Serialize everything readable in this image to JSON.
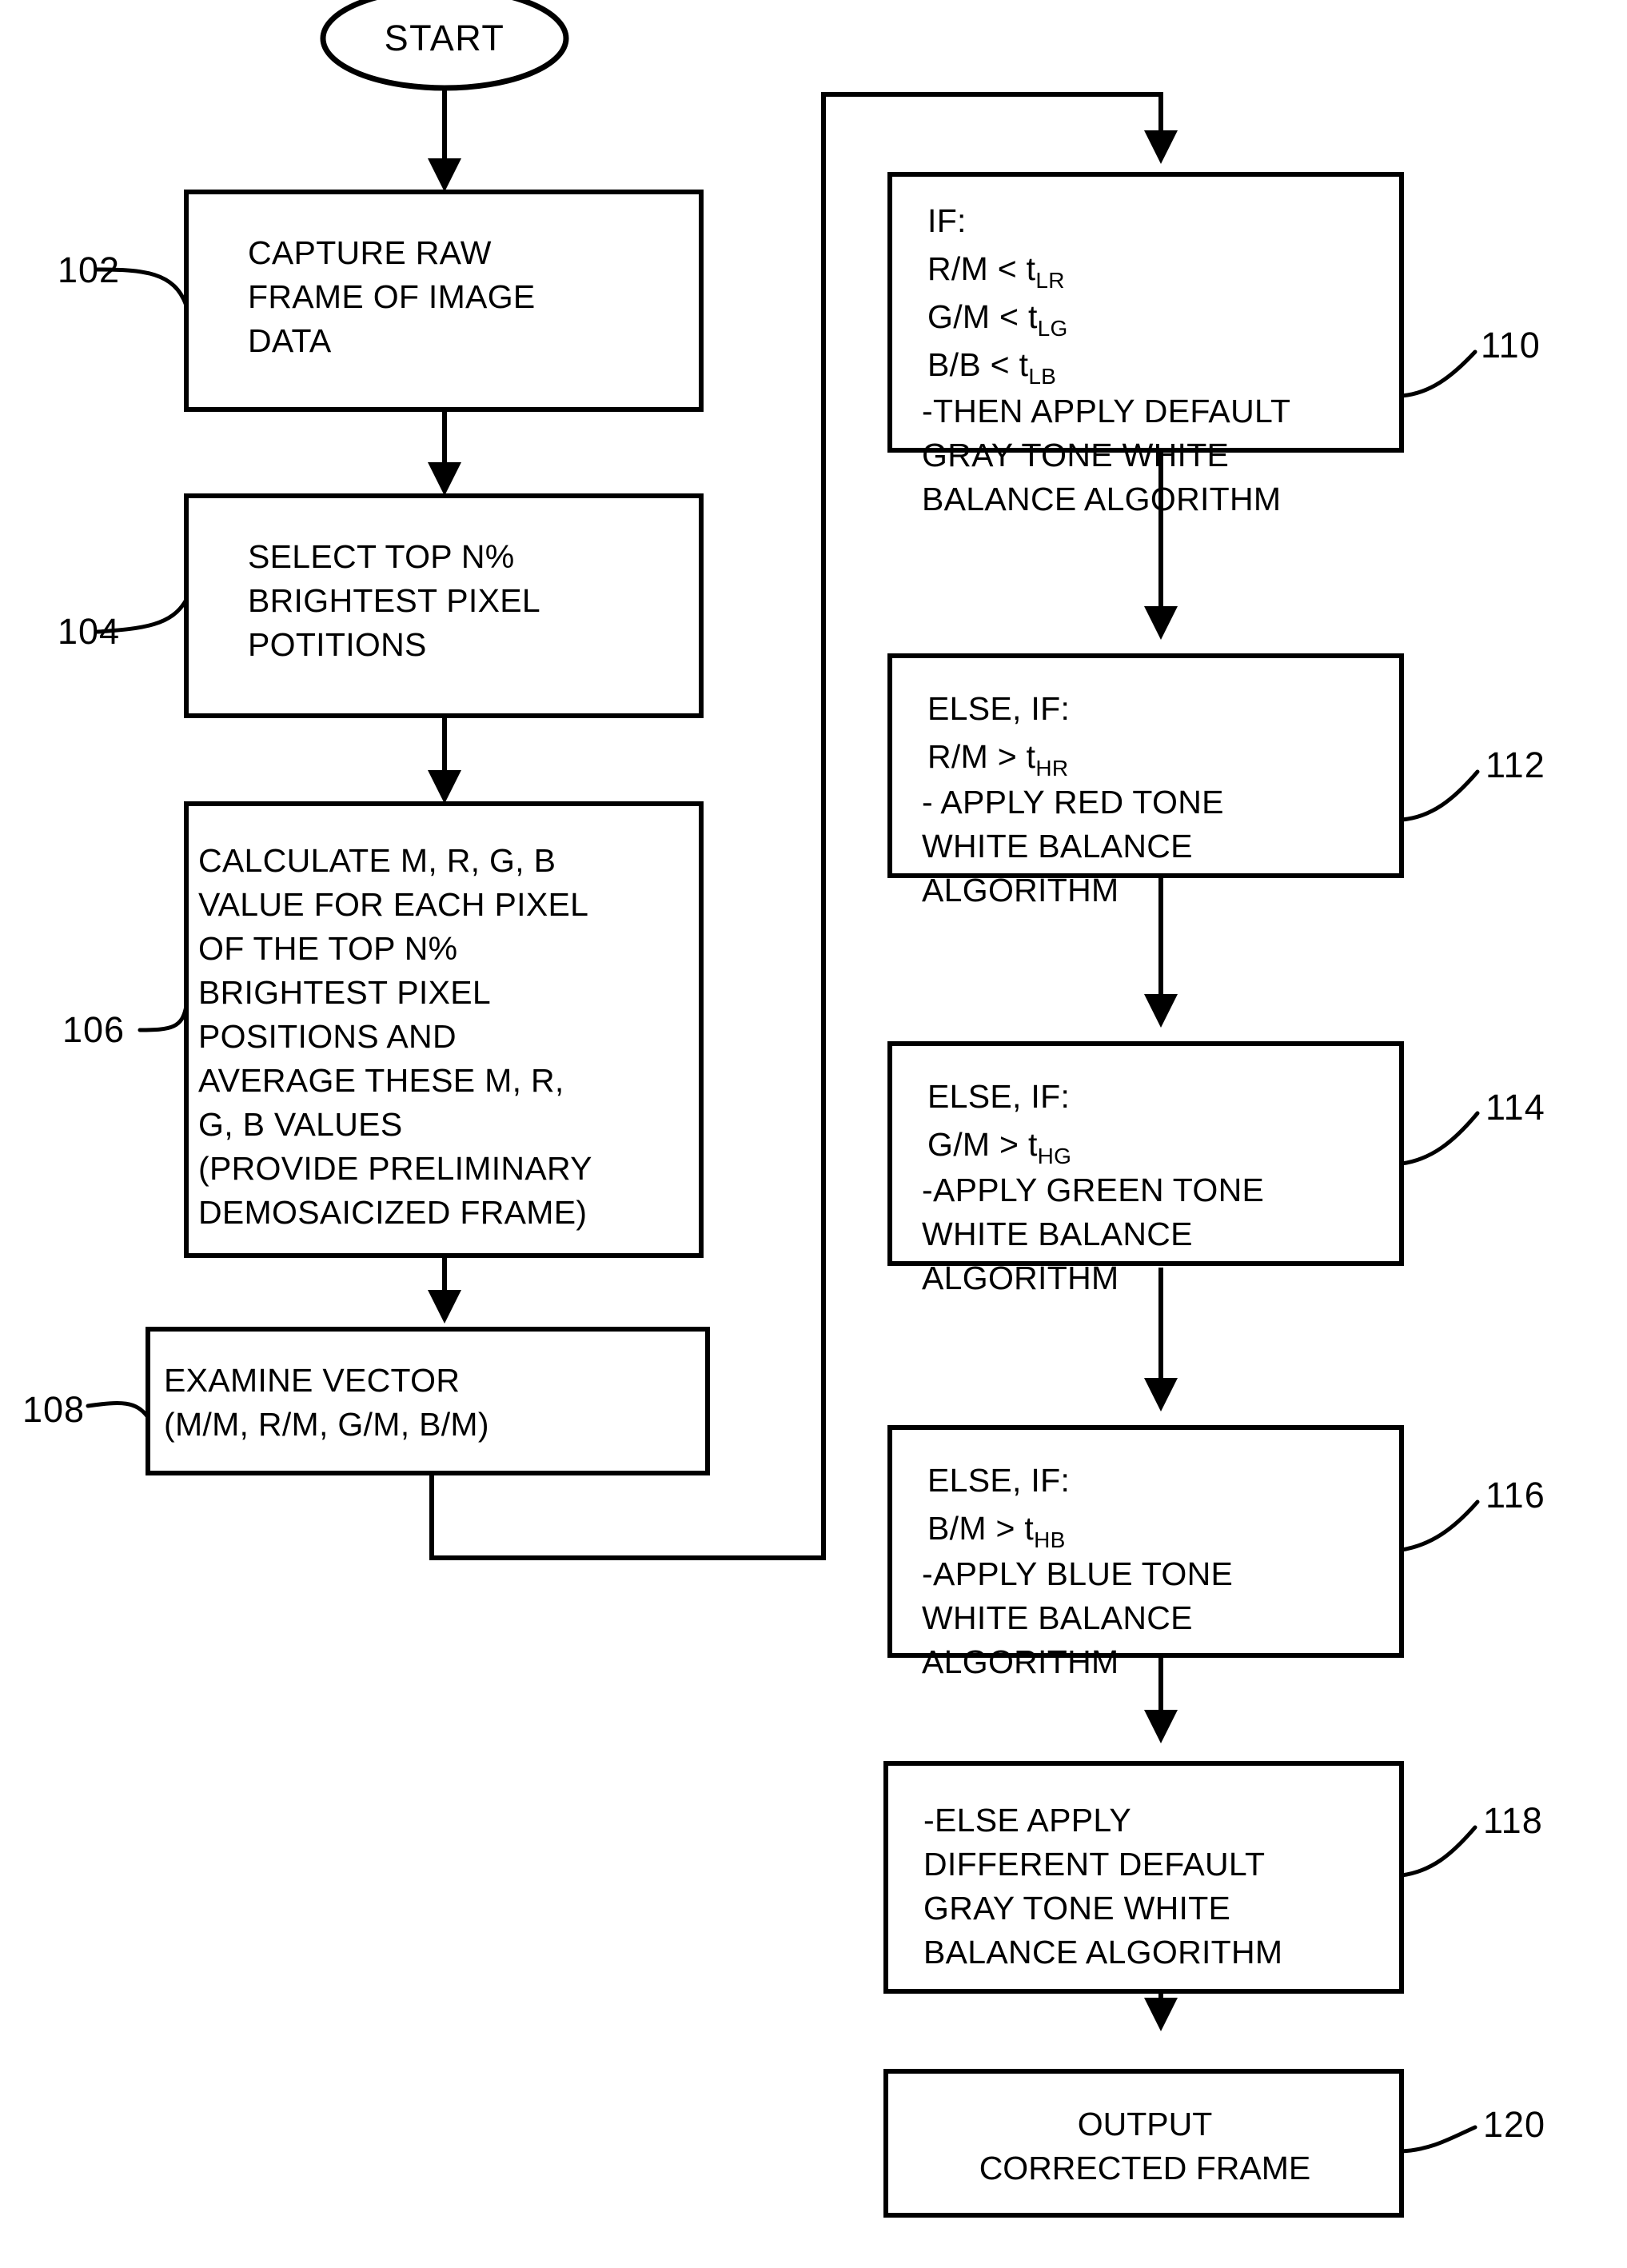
{
  "figure": {
    "type": "patent-flowchart",
    "background_color": "#ffffff",
    "line_color": "#000000"
  },
  "nodes": {
    "start": {
      "shape": "ellipse",
      "label": "START"
    },
    "n102": {
      "ref": "102",
      "shape": "rect",
      "align": "left",
      "lines": [
        "CAPTURE RAW",
        "FRAME OF IMAGE",
        "DATA"
      ]
    },
    "n104": {
      "ref": "104",
      "shape": "rect",
      "align": "left",
      "lines": [
        "SELECT TOP N%",
        "BRIGHTEST PIXEL",
        "POTITIONS"
      ]
    },
    "n106": {
      "ref": "106",
      "shape": "rect",
      "align": "left",
      "lines": [
        "CALCULATE M, R, G, B",
        "VALUE FOR EACH PIXEL",
        "OF THE TOP N%",
        "BRIGHTEST PIXEL",
        "POSITIONS AND",
        "AVERAGE THESE M, R,",
        "G, B VALUES",
        "(PROVIDE PRELIMINARY",
        "DEMOSAICIZED FRAME)"
      ]
    },
    "n108": {
      "ref": "108",
      "shape": "rect",
      "align": "left",
      "lines": [
        "EXAMINE VECTOR",
        "(M/M, R/M, G/M, B/M)"
      ]
    },
    "n110": {
      "ref": "110",
      "shape": "rect",
      "align": "left",
      "lines": [
        {
          "text": "IF:"
        },
        {
          "text": "R/M < t",
          "sub": "LR"
        },
        {
          "text": "G/M < t",
          "sub": "LG"
        },
        {
          "text": "B/B < t",
          "sub": "LB"
        },
        {
          "text": "-THEN APPLY DEFAULT"
        },
        {
          "text": "GRAY TONE WHITE"
        },
        {
          "text": "BALANCE ALGORITHM"
        }
      ]
    },
    "n112": {
      "ref": "112",
      "shape": "rect",
      "align": "left",
      "lines": [
        {
          "text": "ELSE, IF:"
        },
        {
          "text": "R/M > t",
          "sub": "HR"
        },
        {
          "text": "- APPLY RED TONE"
        },
        {
          "text": "WHITE BALANCE"
        },
        {
          "text": "ALGORITHM"
        }
      ]
    },
    "n114": {
      "ref": "114",
      "shape": "rect",
      "align": "left",
      "lines": [
        {
          "text": "ELSE, IF:"
        },
        {
          "text": "G/M > t",
          "sub": "HG"
        },
        {
          "text": "-APPLY GREEN TONE"
        },
        {
          "text": "WHITE BALANCE"
        },
        {
          "text": "ALGORITHM"
        }
      ]
    },
    "n116": {
      "ref": "116",
      "shape": "rect",
      "align": "left",
      "lines": [
        {
          "text": "ELSE, IF:"
        },
        {
          "text": "B/M > t",
          "sub": "HB"
        },
        {
          "text": "-APPLY BLUE TONE"
        },
        {
          "text": "WHITE BALANCE"
        },
        {
          "text": "ALGORITHM"
        }
      ]
    },
    "n118": {
      "ref": "118",
      "shape": "rect",
      "align": "left",
      "lines": [
        "-ELSE APPLY",
        "DIFFERENT DEFAULT",
        "GRAY TONE WHITE",
        "BALANCE ALGORITHM"
      ]
    },
    "n120": {
      "ref": "120",
      "shape": "rect",
      "align": "center",
      "lines": [
        "OUTPUT",
        "CORRECTED FRAME"
      ]
    }
  },
  "flow_order": [
    "start",
    "n102",
    "n104",
    "n106",
    "n108",
    "n110",
    "n112",
    "n114",
    "n116",
    "n118",
    "n120"
  ]
}
